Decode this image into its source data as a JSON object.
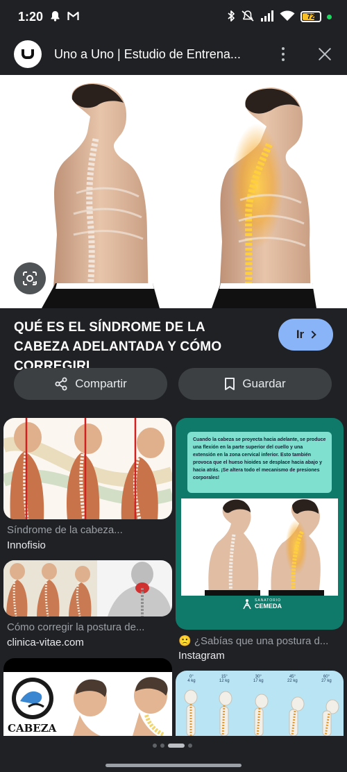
{
  "status_bar": {
    "time": "1:20",
    "battery_level": "72",
    "battery_fraction": 0.72,
    "icons": [
      "bell-icon",
      "gmail-icon",
      "bluetooth-icon",
      "mute-icon",
      "signal-icon",
      "wifi-icon",
      "battery-icon"
    ]
  },
  "header": {
    "site_name": "Uno a Uno | Estudio de Entrena..."
  },
  "result": {
    "title": "QUÉ ES EL SÍNDROME DE LA CABEZA ADELANTADA Y CÓMO CORREGIRL...",
    "go_label": "Ir",
    "share_label": "Compartir",
    "save_label": "Guardar"
  },
  "related": [
    {
      "caption": "Síndrome de la cabeza...",
      "source": "Innofisio"
    },
    {
      "caption": "Cómo corregir la postura de...",
      "source": "clinica-vitae.com"
    },
    {
      "caption": "🙁 ¿Sabías que una postura d...",
      "source": "Instagram"
    }
  ],
  "instagram_card": {
    "text": "Cuando la cabeza se proyecta hacia adelante, se produce una flexión en la parte superior del cuello y una extensión en la zona cervical inferior. Esto también provoca que el hueso hioides se desplace hacia abajo y hacia atrás. ¡Se altera todo el mecanismo de presiones corporales!",
    "brand": "CEMEDA",
    "brand_sub": "SANATORIO"
  },
  "cabeza_card": {
    "label": "CABEZA"
  },
  "weights_card": {
    "angles": [
      "0°",
      "15°",
      "30°",
      "45°",
      "60°"
    ],
    "weights": [
      "4 kg",
      "12 kg",
      "17 kg",
      "22 kg",
      "27 kg"
    ]
  },
  "colors": {
    "background": "#202124",
    "accent": "#8ab4f8",
    "button_bg": "#3c4043",
    "teal": "#0f7a6a"
  }
}
